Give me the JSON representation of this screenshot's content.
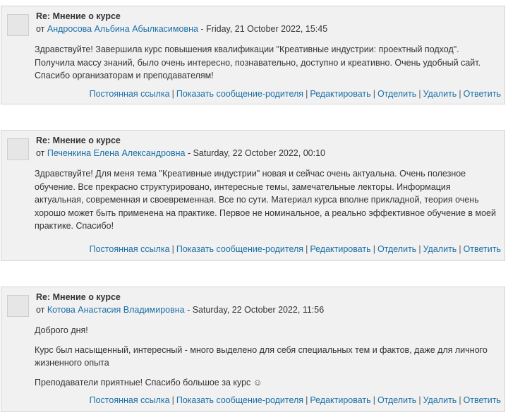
{
  "posts": [
    {
      "subject": "Re: Мнение о курсе",
      "by_prefix": "от",
      "author": "Андросова Альбина Абылкасимовна",
      "date": " - Friday, 21 October 2022, 15:45",
      "paragraphs": [
        "Здравствуйте! Завершила курс повышения квалификации \"Креативные индустрии: проектный подход\". Получила массу знаний, было очень интересно, познавательно, доступно и креативно. Очень удобный сайт. Спасибо организаторам и преподавателям!"
      ]
    },
    {
      "subject": "Re: Мнение о курсе",
      "by_prefix": "от",
      "author": "Печенкина Елена Александровна",
      "date": " - Saturday, 22 October 2022, 00:10",
      "paragraphs": [
        "Здравствуйте! Для меня тема \"Креативные индустрии\" новая и сейчас очень актуальна. Очень полезное обучение. Все прекрасно структурировано, интересные темы, замечательные лекторы. Информация актуальная, современная и своевременная. Все по сути. Материал курса вполне прикладной, теория очень хорошо может быть применена на практике. Первое не номинальное, а реально эффективное обучение в моей практике. Спасибо!"
      ]
    },
    {
      "subject": "Re: Мнение о курсе",
      "by_prefix": "от",
      "author": "Котова Анастасия Владимировна",
      "date": " - Saturday, 22 October 2022, 11:56",
      "paragraphs": [
        "Доброго дня!",
        "Курс был насыщенный, интересный - много выделено для себя специальных тем и фактов, даже для личного жизненного опыта",
        "Преподаватели приятные! Спасибо большое за курс ☺"
      ]
    }
  ],
  "commands": {
    "permalink": "Постоянная ссылка",
    "show_parent": "Показать сообщение-родителя",
    "edit": "Редактировать",
    "split": "Отделить",
    "delete": "Удалить",
    "reply": "Ответить",
    "separator": "|"
  }
}
